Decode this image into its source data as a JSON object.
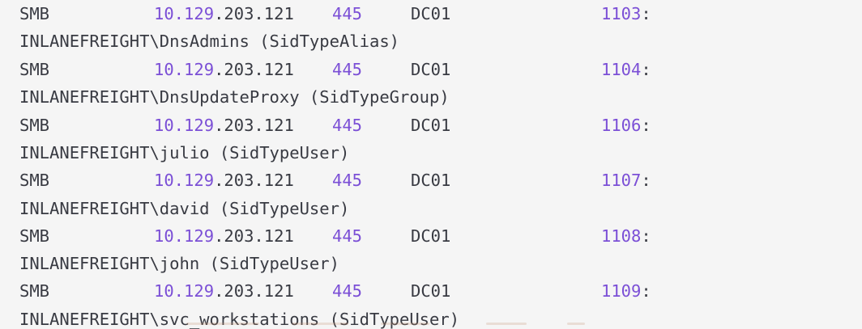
{
  "terminal": {
    "rows": [
      {
        "proto": "SMB",
        "ip_a": "10.129",
        "ip_b": ".203.121",
        "port": "445",
        "host": "DC01",
        "rid": "1103",
        "rid_sep": ":",
        "account": "INLANEFREIGHT\\DnsAdmins (SidTypeAlias)"
      },
      {
        "proto": "SMB",
        "ip_a": "10.129",
        "ip_b": ".203.121",
        "port": "445",
        "host": "DC01",
        "rid": "1104",
        "rid_sep": ":",
        "account": "INLANEFREIGHT\\DnsUpdateProxy (SidTypeGroup)"
      },
      {
        "proto": "SMB",
        "ip_a": "10.129",
        "ip_b": ".203.121",
        "port": "445",
        "host": "DC01",
        "rid": "1106",
        "rid_sep": ":",
        "account": "INLANEFREIGHT\\julio (SidTypeUser)"
      },
      {
        "proto": "SMB",
        "ip_a": "10.129",
        "ip_b": ".203.121",
        "port": "445",
        "host": "DC01",
        "rid": "1107",
        "rid_sep": ":",
        "account": "INLANEFREIGHT\\david (SidTypeUser)"
      },
      {
        "proto": "SMB",
        "ip_a": "10.129",
        "ip_b": ".203.121",
        "port": "445",
        "host": "DC01",
        "rid": "1108",
        "rid_sep": ":",
        "account": "INLANEFREIGHT\\john (SidTypeUser)"
      },
      {
        "proto": "SMB",
        "ip_a": "10.129",
        "ip_b": ".203.121",
        "port": "445",
        "host": "DC01",
        "rid": "1109",
        "rid_sep": ":",
        "account": "INLANEFREIGHT\\svc_workstations (SidTypeUser)"
      }
    ]
  },
  "colors": {
    "background": "#f5f5f5",
    "text": "#383a42",
    "number": "#7b4fd6"
  }
}
